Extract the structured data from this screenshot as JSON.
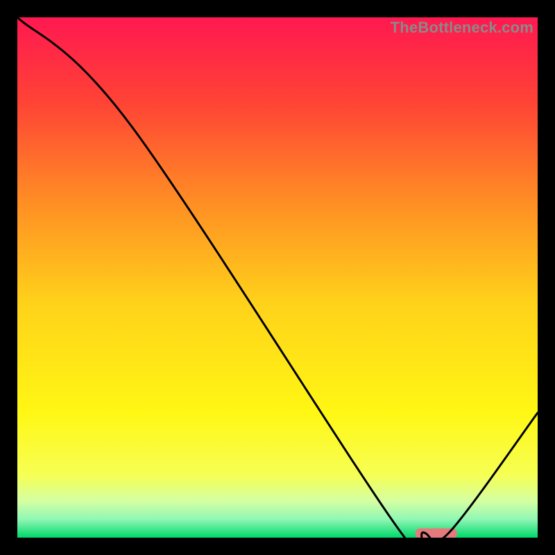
{
  "watermark": "TheBottleneck.com",
  "chart_data": {
    "type": "line",
    "title": "",
    "xlabel": "",
    "ylabel": "",
    "xlim": [
      0,
      100
    ],
    "ylim": [
      0,
      100
    ],
    "grid": false,
    "legend": false,
    "series": [
      {
        "name": "bottleneck-curve",
        "x": [
          0,
          22,
          73,
          78,
          83,
          100
        ],
        "y": [
          100,
          79,
          2,
          1,
          1,
          24
        ],
        "color": "#000000"
      }
    ],
    "markers": [
      {
        "name": "optimal-band",
        "x": 80.5,
        "y": 0.8,
        "width_x": 8,
        "height_y": 2,
        "color": "#e47a7c"
      }
    ],
    "background_gradient": {
      "type": "vertical",
      "stops": [
        {
          "pos": 0.0,
          "color": "#ff1850"
        },
        {
          "pos": 0.16,
          "color": "#ff4236"
        },
        {
          "pos": 0.35,
          "color": "#ff8c24"
        },
        {
          "pos": 0.55,
          "color": "#ffd21a"
        },
        {
          "pos": 0.76,
          "color": "#fff714"
        },
        {
          "pos": 0.88,
          "color": "#f6ff54"
        },
        {
          "pos": 0.93,
          "color": "#d4ffa3"
        },
        {
          "pos": 0.965,
          "color": "#8ff7b4"
        },
        {
          "pos": 1.0,
          "color": "#00d86a"
        }
      ]
    }
  }
}
